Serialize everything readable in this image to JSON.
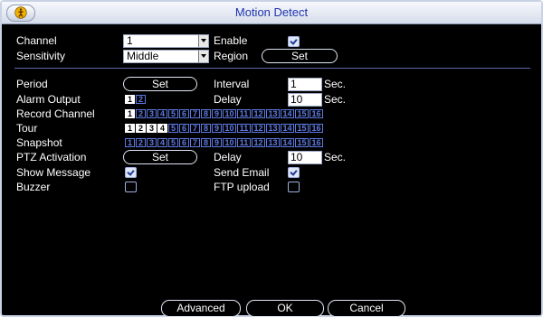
{
  "window": {
    "title": "Motion Detect",
    "icon": "emergency-icon"
  },
  "labels": {
    "channel": "Channel",
    "sensitivity": "Sensitivity",
    "enable": "Enable",
    "region": "Region",
    "period": "Period",
    "interval": "Interval",
    "alarm_output": "Alarm Output",
    "delay": "Delay",
    "record_channel": "Record Channel",
    "tour": "Tour",
    "snapshot": "Snapshot",
    "ptz_activation": "PTZ Activation",
    "delay2": "Delay",
    "show_message": "Show Message",
    "send_email": "Send Email",
    "buzzer": "Buzzer",
    "ftp_upload": "FTP upload",
    "sec": "Sec."
  },
  "fields": {
    "channel": "1",
    "sensitivity": "Middle",
    "interval": "1",
    "delay": "10",
    "ptz_delay": "10"
  },
  "buttons": {
    "region": "Set",
    "period": "Set",
    "ptz": "Set",
    "advanced": "Advanced",
    "ok": "OK",
    "cancel": "Cancel"
  },
  "checkboxes": {
    "enable": true,
    "show_message": true,
    "send_email": true,
    "buzzer": false,
    "ftp_upload": false
  },
  "alarm_output": {
    "items": [
      "1",
      "2"
    ],
    "selected": [
      1
    ]
  },
  "record_channel": {
    "items": [
      "1",
      "2",
      "3",
      "4",
      "5",
      "6",
      "7",
      "8",
      "9",
      "10",
      "11",
      "12",
      "13",
      "14",
      "15",
      "16"
    ],
    "selected": [
      1
    ]
  },
  "tour": {
    "items": [
      "1",
      "2",
      "3",
      "4",
      "5",
      "6",
      "7",
      "8",
      "9",
      "10",
      "11",
      "12",
      "13",
      "14",
      "15",
      "16"
    ],
    "selected": [
      1,
      2,
      3,
      4
    ]
  },
  "snapshot": {
    "items": [
      "1",
      "2",
      "3",
      "4",
      "5",
      "6",
      "7",
      "8",
      "9",
      "10",
      "11",
      "12",
      "13",
      "14",
      "15",
      "16"
    ],
    "selected": []
  }
}
